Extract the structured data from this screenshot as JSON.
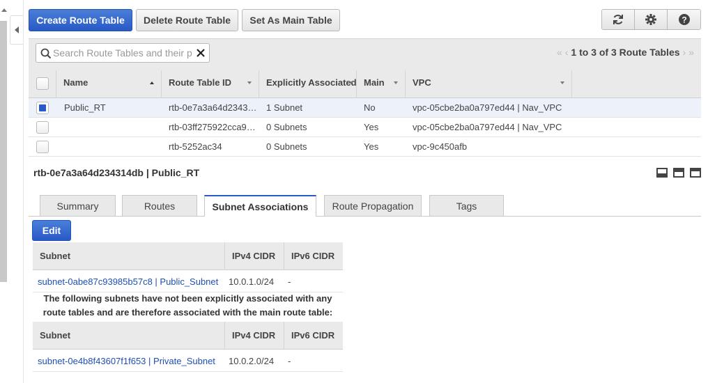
{
  "toolbar": {
    "create_label": "Create Route Table",
    "delete_label": "Delete Route Table",
    "set_main_label": "Set As Main Table"
  },
  "filter": {
    "search_placeholder": "Search Route Tables and their properties",
    "pager_text": "1 to 3 of 3 Route Tables"
  },
  "grid": {
    "columns": [
      "Name",
      "Route Table ID",
      "Explicitly Associated With",
      "Main",
      "VPC"
    ],
    "rows": [
      {
        "name": "Public_RT",
        "id": "rtb-0e7a3a64d234314db",
        "id_display": "rtb-0e7a3a64d2343…",
        "assoc": "1 Subnet",
        "main": "No",
        "vpc": "vpc-05cbe2ba0a797ed44 | Nav_VPC",
        "selected": true
      },
      {
        "name": "",
        "id": "rtb-03ff275922cca9",
        "id_display": "rtb-03ff275922cca9…",
        "assoc": "0 Subnets",
        "main": "Yes",
        "vpc": "vpc-05cbe2ba0a797ed44 | Nav_VPC",
        "selected": false
      },
      {
        "name": "",
        "id": "rtb-5252ac34",
        "id_display": "rtb-5252ac34",
        "assoc": "0 Subnets",
        "main": "Yes",
        "vpc": "vpc-9c450afb",
        "selected": false
      }
    ]
  },
  "detail": {
    "title": "rtb-0e7a3a64d234314db | Public_RT",
    "tabs": [
      "Summary",
      "Routes",
      "Subnet Associations",
      "Route Propagation",
      "Tags"
    ],
    "active_tab": "Subnet Associations",
    "edit_label": "Edit",
    "subnet_headers": [
      "Subnet",
      "IPv4 CIDR",
      "IPv6 CIDR"
    ],
    "explicit_subnets": [
      {
        "subnet": "subnet-0abe87c93985b57c8 | Public_Subnet",
        "ipv4": "10.0.1.0/24",
        "ipv6": "-"
      }
    ],
    "notice": "The following subnets have not been explicitly associated with any route tables and are therefore associated with the main route table:",
    "implicit_subnets": [
      {
        "subnet": "subnet-0e4b8f43607f1f653 | Private_Subnet",
        "ipv4": "10.0.2.0/24",
        "ipv6": "-"
      }
    ]
  },
  "colors": {
    "primary": "#2859c6",
    "link": "#1e4fb4",
    "selected_row": "#edf2fa"
  }
}
